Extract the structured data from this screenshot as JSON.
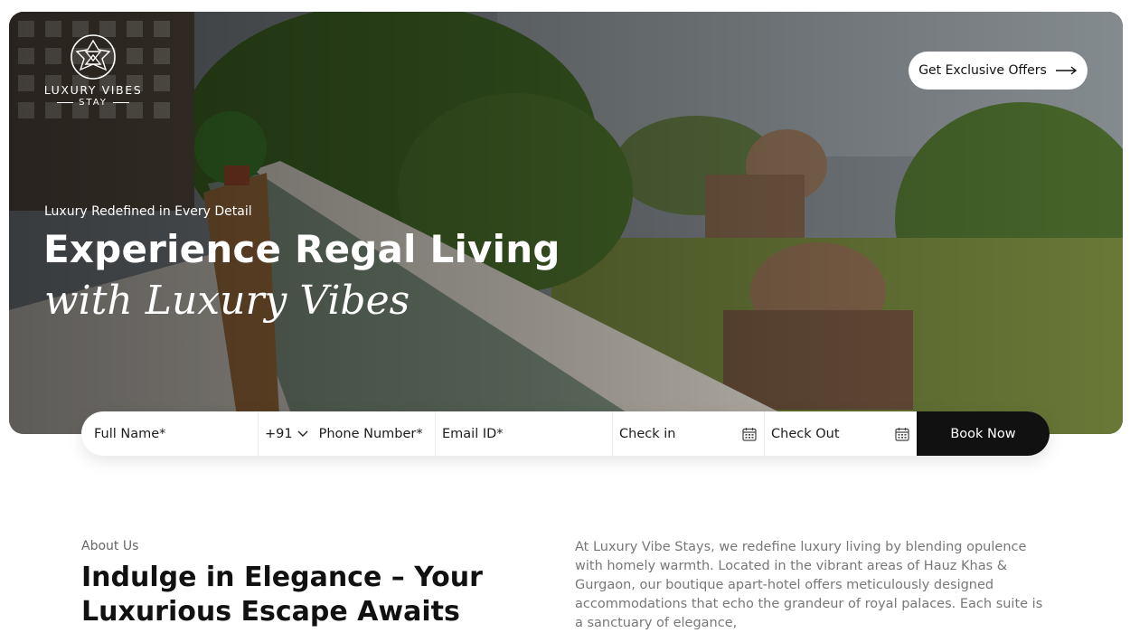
{
  "header": {
    "brand": "LUXURY VIBES",
    "brand_sub": "STAY",
    "offers_button": "Get Exclusive Offers"
  },
  "hero": {
    "tagline": "Luxury Redefined in Every Detail",
    "headline": "Experience Regal Living",
    "headline_script": "with Luxury Vibes"
  },
  "booking": {
    "name_placeholder": "Full Name*",
    "country_code": "+91",
    "phone_placeholder": "Phone Number*",
    "email_placeholder": "Email ID*",
    "checkin_placeholder": "Check in",
    "checkout_placeholder": "Check Out",
    "submit": "Book Now"
  },
  "about": {
    "label": "About Us",
    "title": "Indulge in Elegance – Your Luxurious Escape Awaits",
    "text": "At Luxury Vibe Stays, we redefine luxury living by blending opulence with homely warmth. Located in the vibrant areas of Hauz Khas & Gurgaon, our boutique apart-hotel offers meticulously designed accommodations that echo the grandeur of royal palaces. Each suite is a sanctuary of elegance,"
  }
}
